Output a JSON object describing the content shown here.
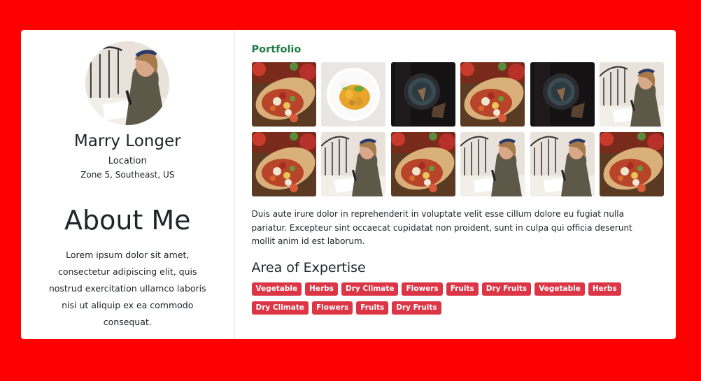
{
  "profile": {
    "name": "Marry Longer",
    "location_label": "Location",
    "location_value": "Zone 5, Southeast, US"
  },
  "about": {
    "title": "About Me",
    "text": "Lorem ipsum dolor sit amet, consectetur adipiscing elit, quis nostrud exercitation ullamco laboris nisi ut aliquip ex ea commodo consequat."
  },
  "portfolio": {
    "title": "Portfolio",
    "images": [
      "burrito",
      "curry-plate",
      "dark-bowl",
      "burrito",
      "dark-bowl",
      "woman-writing",
      "burrito",
      "woman-writing",
      "burrito",
      "woman-writing",
      "woman-writing",
      "burrito"
    ],
    "description": "Duis aute irure dolor in reprehenderit in voluptate velit esse cillum dolore eu fugiat nulla pariatur. Excepteur sint occaecat cupidatat non proident, sunt in culpa qui officia deserunt mollit anim id est laborum."
  },
  "expertise": {
    "title": "Area of Expertise",
    "tags": [
      "Vegetable",
      "Herbs",
      "Dry Climate",
      "Flowers",
      "Fruits",
      "Dry Fruits",
      "Vegetable",
      "Herbs",
      "Dry Climate",
      "Flowers",
      "Fruits",
      "Dry Fruits"
    ]
  },
  "colors": {
    "page_background": "#ff0000",
    "tag_background": "#dc3545",
    "portfolio_title": "#1e7e45"
  }
}
